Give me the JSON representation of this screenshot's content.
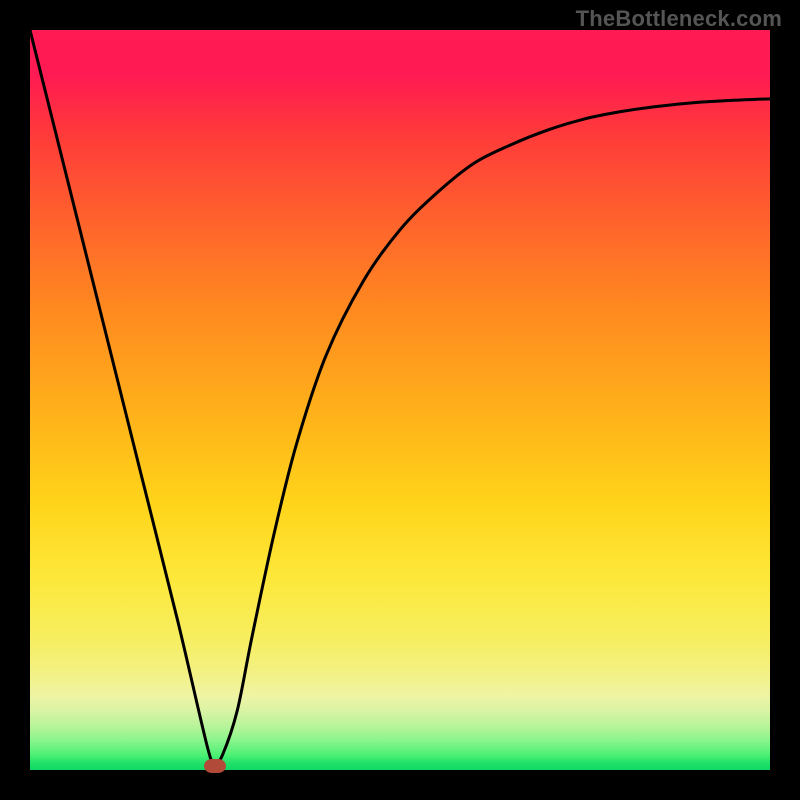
{
  "watermark": "TheBottleneck.com",
  "chart_data": {
    "type": "line",
    "title": "",
    "xlabel": "",
    "ylabel": "",
    "xlim": [
      0,
      100
    ],
    "ylim": [
      0,
      100
    ],
    "grid": false,
    "legend": false,
    "series": [
      {
        "name": "curve",
        "x": [
          0,
          5,
          10,
          15,
          20,
          24,
          25,
          26,
          28,
          30,
          33,
          36,
          40,
          45,
          50,
          55,
          60,
          65,
          70,
          75,
          80,
          85,
          90,
          95,
          100
        ],
        "y": [
          100,
          80,
          60,
          40,
          20,
          3,
          1,
          2,
          8,
          18,
          32,
          44,
          56,
          66,
          73,
          78,
          82,
          84.5,
          86.5,
          88,
          89,
          89.7,
          90.2,
          90.5,
          90.7
        ]
      }
    ],
    "marker": {
      "x": 25,
      "y": 0.6
    },
    "gradient_stops": [
      {
        "pos": 0,
        "color": "#ff1a53"
      },
      {
        "pos": 50,
        "color": "#ffb21a"
      },
      {
        "pos": 85,
        "color": "#f3f185"
      },
      {
        "pos": 100,
        "color": "#0fd764"
      }
    ]
  }
}
